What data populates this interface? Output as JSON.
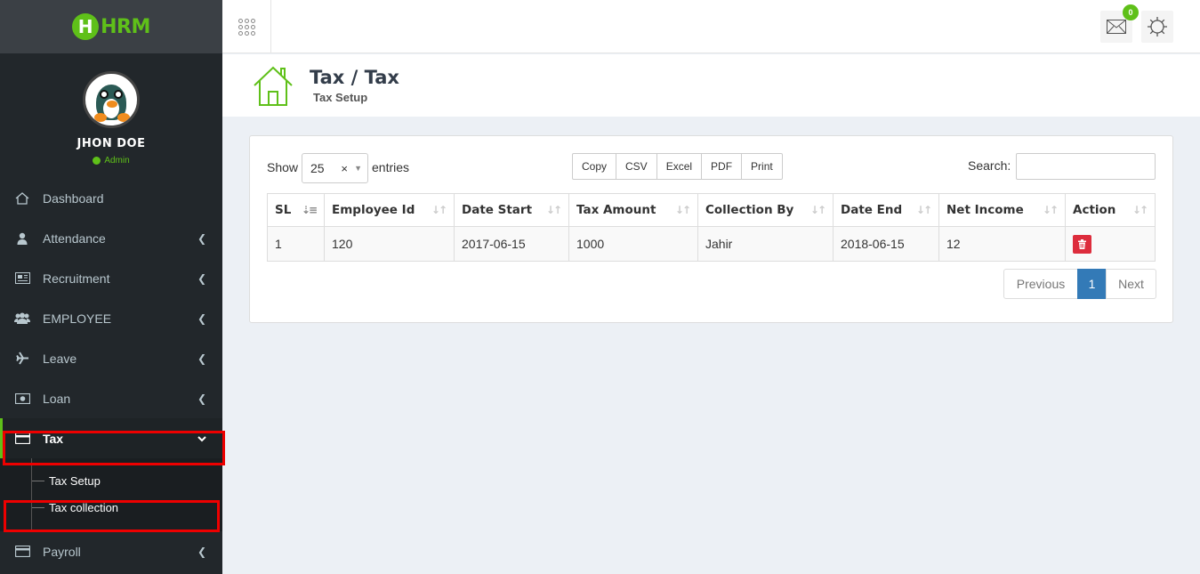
{
  "app": {
    "logo_letter": "H",
    "logo_text": "HRM"
  },
  "profile": {
    "name": "JHON DOE",
    "role": "Admin"
  },
  "sidebar": {
    "items": [
      {
        "label": "Dashboard",
        "icon": "home-icon"
      },
      {
        "label": "Attendance",
        "icon": "user-icon"
      },
      {
        "label": "Recruitment",
        "icon": "newspaper-icon"
      },
      {
        "label": "EMPLOYEE",
        "icon": "users-icon"
      },
      {
        "label": "Leave",
        "icon": "plane-icon"
      },
      {
        "label": "Loan",
        "icon": "money-icon"
      },
      {
        "label": "Tax",
        "icon": "credit-card-icon",
        "active": true
      },
      {
        "label": "Payroll",
        "icon": "credit-card-icon"
      }
    ],
    "tax_submenu": [
      {
        "label": "Tax Setup"
      },
      {
        "label": "Tax collection"
      }
    ]
  },
  "topbar": {
    "notification_count": "0"
  },
  "page": {
    "title": "Tax / Tax",
    "subtitle": "Tax Setup"
  },
  "table_controls": {
    "show_label": "Show",
    "page_length": "25",
    "clear_glyph": "×",
    "entries_label": "entries",
    "export_buttons": [
      "Copy",
      "CSV",
      "Excel",
      "PDF",
      "Print"
    ],
    "search_label": "Search:",
    "search_value": ""
  },
  "table": {
    "columns": [
      "SL",
      "Employee Id",
      "Date Start",
      "Tax Amount",
      "Collection By",
      "Date End",
      "Net Income",
      "Action"
    ],
    "rows": [
      [
        "1",
        "120",
        "2017-06-15",
        "1000",
        "Jahir",
        "2018-06-15",
        "12"
      ]
    ]
  },
  "pagination": {
    "previous": "Previous",
    "current": "1",
    "next": "Next"
  },
  "colors": {
    "accent": "#5fc019",
    "sidebar_bg": "#22272b",
    "primary": "#337ab7",
    "danger": "#dd2d3d",
    "highlight": "#ee0000"
  }
}
